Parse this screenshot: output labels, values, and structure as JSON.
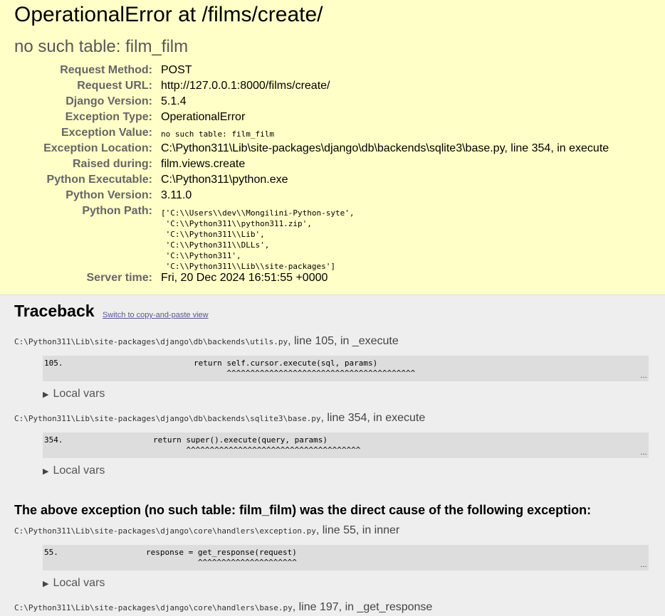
{
  "summary": {
    "title": "OperationalError at /films/create/",
    "subtitle": "no such table: film_film",
    "meta": [
      {
        "label": "Request Method:",
        "value": "POST"
      },
      {
        "label": "Request URL:",
        "value": "http://127.0.0.1:8000/films/create/"
      },
      {
        "label": "Django Version:",
        "value": "5.1.4"
      },
      {
        "label": "Exception Type:",
        "value": "OperationalError"
      },
      {
        "label": "Exception Value:",
        "value": "no such table: film_film"
      },
      {
        "label": "Exception Location:",
        "value": "C:\\Python311\\Lib\\site-packages\\django\\db\\backends\\sqlite3\\base.py, line 354, in execute"
      },
      {
        "label": "Raised during:",
        "value": "film.views.create"
      },
      {
        "label": "Python Executable:",
        "value": "C:\\Python311\\python.exe"
      },
      {
        "label": "Python Version:",
        "value": "3.11.0"
      },
      {
        "label": "Python Path:",
        "value": "['C:\\\\Users\\\\dev\\\\Mongilini-Python-syte',\n 'C:\\\\Python311\\\\python311.zip',\n 'C:\\\\Python311\\\\Lib',\n 'C:\\\\Python311\\\\DLLs',\n 'C:\\\\Python311',\n 'C:\\\\Python311\\\\Lib\\\\site-packages']"
      },
      {
        "label": "Server time:",
        "value": "Fri, 20 Dec 2024 16:51:55 +0000"
      }
    ]
  },
  "traceback": {
    "heading": "Traceback",
    "switch_link": "Switch to copy-and-paste view",
    "local_vars_label": "Local vars",
    "cause_text": "The above exception (no such table: film_film) was the direct cause of the following exception:",
    "frames": [
      {
        "filename": "C:\\Python311\\Lib\\site-packages\\django\\db\\backends\\utils.py",
        "location": ", line 105, in _execute",
        "lineno": "105.",
        "code": "return self.cursor.execute(sql, params)\n       ^^^^^^^^^^^^^^^^^^^^^^^^^^^^^^^^^^^^^^^^",
        "ellipsis": "…"
      },
      {
        "filename": "C:\\Python311\\Lib\\site-packages\\django\\db\\backends\\sqlite3\\base.py",
        "location": ", line 354, in execute",
        "lineno": "354.",
        "code": "return super().execute(query, params)\n       ^^^^^^^^^^^^^^^^^^^^^^^^^^^^^^^^^^^^^",
        "ellipsis": "…"
      },
      {
        "filename": "C:\\Python311\\Lib\\site-packages\\django\\core\\handlers\\exception.py",
        "location": ", line 55, in inner",
        "lineno": "55.",
        "code": "response = get_response(request)\n           ^^^^^^^^^^^^^^^^^^^^^",
        "ellipsis": "…"
      },
      {
        "filename": "C:\\Python311\\Lib\\site-packages\\django\\core\\handlers\\base.py",
        "location": ", line 197, in _get_response"
      }
    ]
  }
}
